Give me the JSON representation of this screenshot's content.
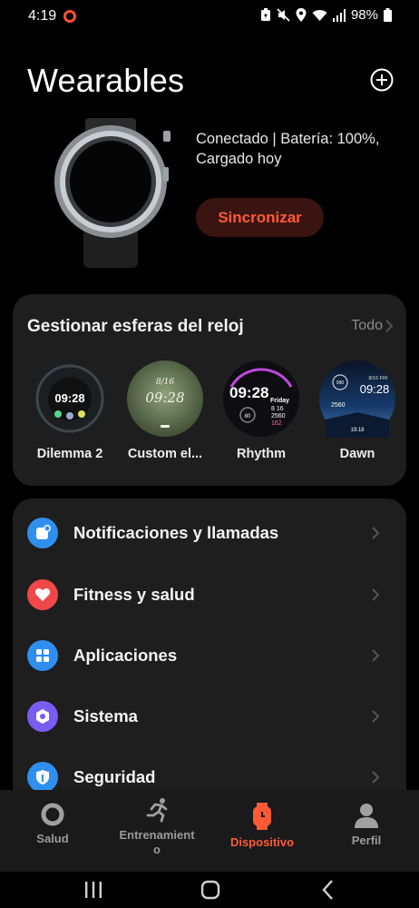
{
  "status_bar": {
    "time": "4:19",
    "battery": "98%"
  },
  "header": {
    "title": "Wearables",
    "add_icon": "plus-circle-icon"
  },
  "device": {
    "status_text": "Conectado | Batería: 100%, Cargado hoy",
    "sync_label": "Sincronizar",
    "accent_color": "#ff5a36"
  },
  "faces": {
    "title": "Gestionar esferas del reloj",
    "all_label": "Todo",
    "items": [
      {
        "label": "Dilemma 2",
        "time": "09:28"
      },
      {
        "label": "Custom el...",
        "time": "09:28",
        "date": "8/16"
      },
      {
        "label": "Rhythm",
        "time": "09:28",
        "day": "Friday",
        "date": "8 16",
        "steps": "2560",
        "hr": "162",
        "extra": "80"
      },
      {
        "label": "Dawn",
        "time": "09:28",
        "date": "8/16 FRI",
        "steps": "2560",
        "clock": "19:18",
        "top": "990"
      }
    ]
  },
  "menu": {
    "items": [
      {
        "label": "Notificaciones y llamadas",
        "icon": "notification-icon",
        "color": "#2f8ff0"
      },
      {
        "label": "Fitness y salud",
        "icon": "heart-icon",
        "color": "#f04848"
      },
      {
        "label": "Aplicaciones",
        "icon": "apps-grid-icon",
        "color": "#2f8ff0"
      },
      {
        "label": "Sistema",
        "icon": "settings-icon",
        "color": "#7a5cf0"
      },
      {
        "label": "Seguridad",
        "icon": "shield-icon",
        "color": "#2f8ff0"
      }
    ]
  },
  "bottom_nav": {
    "items": [
      {
        "label": "Salud",
        "icon": "ring-icon"
      },
      {
        "label": "Entrenamient o",
        "icon": "running-icon"
      },
      {
        "label": "Dispositivo",
        "icon": "watch-icon",
        "active": true
      },
      {
        "label": "Perfil",
        "icon": "person-icon"
      }
    ]
  }
}
